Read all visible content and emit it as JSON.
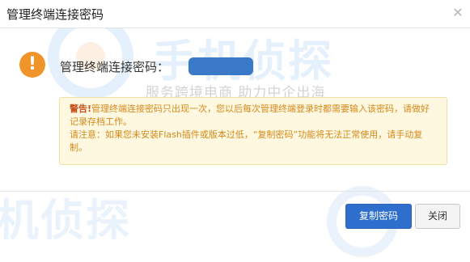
{
  "dialog": {
    "title": "管理终端连接密码",
    "close_icon": "close-icon"
  },
  "watermark": {
    "brand": "手机侦探",
    "slogan": "服务跨境电商  助力中企出海",
    "bottom": "机侦探"
  },
  "content": {
    "warning_icon": "!",
    "password_label": "管理终端连接密码：",
    "password_value": "••••••"
  },
  "notice": {
    "warning_prefix": "警告!",
    "warning_text": "管理终端连接密码只出现一次，您以后每次管理终端登录时都需要输入该密码，请做好记录存档工作。",
    "note_text": "请注意：如果您未安装Flash插件或版本过低，“复制密码”功能将无法正常使用，请手动复制。"
  },
  "footer": {
    "copy_button": "复制密码",
    "close_button": "关闭"
  },
  "colors": {
    "primary": "#2e6fce",
    "warning_orange": "#f0952a",
    "notice_bg": "#fff8e1",
    "notice_text": "#d4891a"
  }
}
